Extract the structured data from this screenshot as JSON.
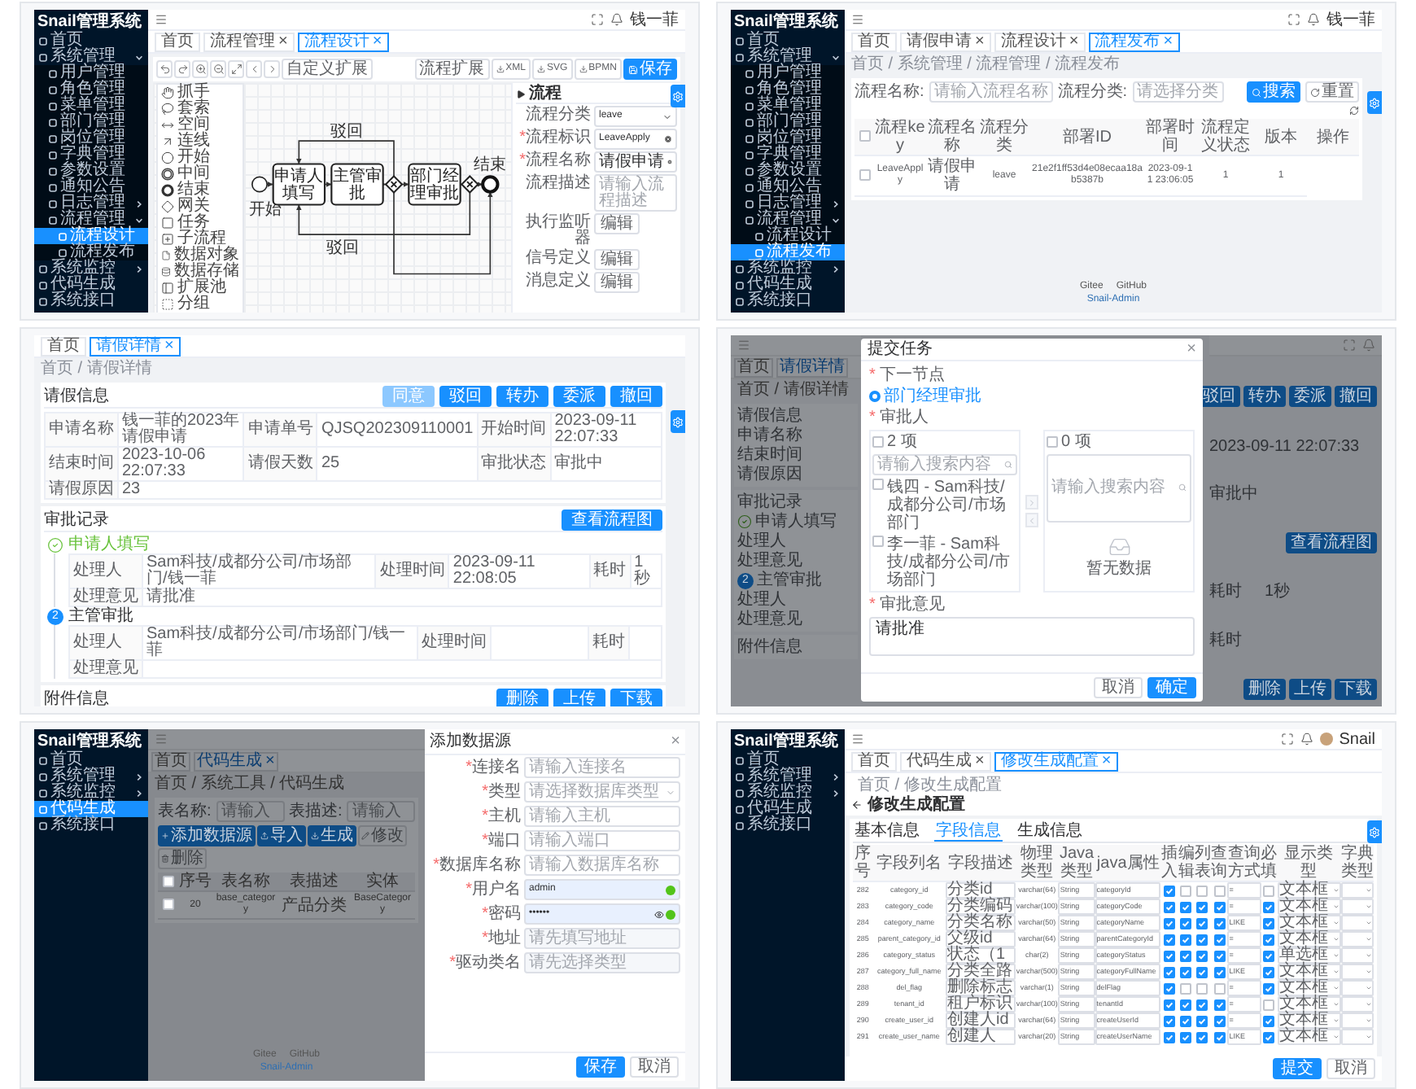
{
  "panels": [
    {
      "kind": "designer",
      "sidebar": {
        "title": "Snail管理系统",
        "items": [
          {
            "label": "首页",
            "selected": false
          },
          {
            "label": "系统管理",
            "selected": false,
            "expanded": true,
            "children": [
              {
                "label": "用户管理",
                "selected": false
              },
              {
                "label": "角色管理",
                "selected": false
              },
              {
                "label": "菜单管理",
                "selected": false
              },
              {
                "label": "部门管理",
                "selected": false
              },
              {
                "label": "岗位管理",
                "selected": false
              },
              {
                "label": "字典管理",
                "selected": false
              },
              {
                "label": "参数设置",
                "selected": false
              },
              {
                "label": "通知公告",
                "selected": false
              },
              {
                "label": "日志管理",
                "selected": false,
                "expanded": false
              },
              {
                "label": "流程管理",
                "selected": false,
                "expanded": true,
                "children": [
                  {
                    "label": "流程设计",
                    "selected": true
                  },
                  {
                    "label": "流程发布",
                    "selected": false
                  }
                ]
              }
            ]
          },
          {
            "label": "系统监控",
            "selected": false,
            "expanded": false
          },
          {
            "label": "代码生成",
            "selected": false
          },
          {
            "label": "系统接口",
            "selected": false
          }
        ]
      },
      "header": {
        "user": "钱一菲"
      },
      "tabs": [
        {
          "label": "首页",
          "selected": false
        },
        {
          "label": "流程管理",
          "close": "×",
          "selected": false
        },
        {
          "label": "流程设计",
          "close": "×",
          "selected": true
        }
      ],
      "tools": [
        {
          "kind": "undo"
        },
        {
          "kind": "redo"
        },
        {
          "kind": "zoom-in"
        },
        {
          "kind": "zoom-out"
        },
        {
          "kind": "fit"
        },
        {
          "kind": "left"
        },
        {
          "kind": "right"
        }
      ],
      "extension_button": "自定义扩展",
      "actions": [
        {
          "kind": "text",
          "label": "流程扩展",
          "primary": false
        },
        {
          "kind": "download",
          "label": "XML",
          "primary": false
        },
        {
          "kind": "download",
          "label": "SVG",
          "primary": false
        },
        {
          "kind": "download",
          "label": "BPMN",
          "primary": false
        },
        {
          "kind": "save",
          "label": "保存",
          "primary": true
        }
      ],
      "palette": [
        {
          "kind": "hand",
          "label": "抓手"
        },
        {
          "kind": "lasso",
          "label": "套索"
        },
        {
          "kind": "space",
          "label": "空间"
        },
        {
          "kind": "connect",
          "label": "连线"
        },
        {
          "kind": "start",
          "label": "开始"
        },
        {
          "kind": "intermediate",
          "label": "中间"
        },
        {
          "kind": "end",
          "label": "结束"
        },
        {
          "kind": "gateway",
          "label": "网关"
        },
        {
          "kind": "task",
          "label": "任务"
        },
        {
          "kind": "subprocess",
          "label": "子流程"
        },
        {
          "kind": "data-object",
          "label": "数据对象"
        },
        {
          "kind": "data-store",
          "label": "数据存储"
        },
        {
          "kind": "pool",
          "label": "扩展池"
        },
        {
          "kind": "group",
          "label": "分组"
        }
      ],
      "diagram": {
        "start_label": "开始",
        "end_label": "结束",
        "tasks": [
          "申请人填写",
          "主管审批",
          "部门经理审批"
        ],
        "flow_labels": [
          "驳回",
          "驳回"
        ]
      },
      "properties": {
        "title": "流程",
        "fields": [
          {
            "kind": "select",
            "label": "流程分类",
            "value": "leave"
          },
          {
            "kind": "input",
            "label": "流程标识",
            "value": "LeaveApply",
            "required": "*"
          },
          {
            "kind": "input",
            "label": "流程名称",
            "value": "请假申请",
            "required": "*"
          },
          {
            "kind": "textarea",
            "label": "流程描述",
            "placeholder": "请输入流程描述"
          },
          {
            "kind": "button",
            "label": "执行监听器",
            "value": "编辑"
          },
          {
            "kind": "button",
            "label": "信号定义",
            "value": "编辑"
          },
          {
            "kind": "button",
            "label": "消息定义",
            "value": "编辑"
          }
        ]
      }
    },
    {
      "kind": "deploy_list",
      "sidebar": {
        "title": "Snail管理系统",
        "items": [
          {
            "label": "首页",
            "selected": false
          },
          {
            "label": "系统管理",
            "selected": false,
            "expanded": true,
            "children": [
              {
                "label": "用户管理",
                "selected": false
              },
              {
                "label": "角色管理",
                "selected": false
              },
              {
                "label": "菜单管理",
                "selected": false
              },
              {
                "label": "部门管理",
                "selected": false
              },
              {
                "label": "岗位管理",
                "selected": false
              },
              {
                "label": "字典管理",
                "selected": false
              },
              {
                "label": "参数设置",
                "selected": false
              },
              {
                "label": "通知公告",
                "selected": false
              },
              {
                "label": "日志管理",
                "selected": false,
                "expanded": false
              },
              {
                "label": "流程管理",
                "selected": false,
                "expanded": true,
                "children": [
                  {
                    "label": "流程设计",
                    "selected": false
                  },
                  {
                    "label": "流程发布",
                    "selected": true
                  }
                ]
              }
            ]
          },
          {
            "label": "系统监控",
            "selected": false,
            "expanded": false
          },
          {
            "label": "代码生成",
            "selected": false
          },
          {
            "label": "系统接口",
            "selected": false
          }
        ]
      },
      "header": {
        "user": "钱一菲"
      },
      "tabs": [
        {
          "label": "首页",
          "selected": false
        },
        {
          "label": "请假申请",
          "close": "×",
          "selected": false
        },
        {
          "label": "流程设计",
          "close": "×",
          "selected": false
        },
        {
          "label": "流程发布",
          "close": "×",
          "selected": true
        }
      ],
      "breadcrumb": "首页 / 系统管理 / 流程管理 / 流程发布",
      "search": {
        "fields": [
          {
            "label": "流程名称:",
            "placeholder": "请输入流程名称"
          },
          {
            "label": "流程分类:",
            "placeholder": "请选择分类"
          }
        ],
        "buttons": [
          {
            "label": "搜索",
            "primary": true
          },
          {
            "label": "重置",
            "primary": false
          }
        ]
      },
      "table": {
        "all_checked": false,
        "columns": [
          "流程key",
          "流程名称",
          "流程分类",
          "部署ID",
          "部署时间",
          "流程定义状态",
          "版本",
          "操作"
        ],
        "rows": [
          {
            "checked": false,
            "cells": [
              "LeaveApply",
              "请假申请",
              "leave",
              "21e2f1ff53d4e08ecaa18ab5387b",
              "2023-09-11 23:06:05",
              "1",
              "1"
            ]
          }
        ]
      },
      "footer": {
        "links": [
          "Gitee",
          "GitHub"
        ],
        "brand": "Snail-Admin"
      }
    },
    {
      "kind": "detail",
      "tabs": [
        {
          "label": "首页",
          "selected": false
        },
        {
          "label": "请假详情",
          "close": "×",
          "selected": true
        }
      ],
      "breadcrumb": "首页 / 请假详情",
      "info": {
        "title": "请假信息",
        "buttons": [
          {
            "label": "同意",
            "disabled": true
          },
          {
            "label": "驳回",
            "disabled": false
          },
          {
            "label": "转办",
            "disabled": false
          },
          {
            "label": "委派",
            "disabled": false
          },
          {
            "label": "撤回",
            "disabled": false
          }
        ],
        "rows": [
          [
            {
              "label": "申请名称",
              "value": "钱一菲的2023年请假申请"
            },
            {
              "label": "申请单号",
              "value": "QJSQ202309110001"
            },
            {
              "label": "开始时间",
              "value": "2023-09-11 22:07:33"
            }
          ],
          [
            {
              "label": "结束时间",
              "value": "2023-10-06 22:07:33"
            },
            {
              "label": "请假天数",
              "value": "25"
            },
            {
              "label": "审批状态",
              "value": "审批中"
            }
          ],
          [
            {
              "label": "请假原因",
              "value": "23"
            }
          ]
        ]
      },
      "records": {
        "title": "审批记录",
        "button": "查看流程图",
        "steps": [
          {
            "title": "申请人填写",
            "done": true,
            "handler_label": "处理人",
            "handler": "Sam科技/成都分公司/市场部门/钱一菲",
            "time_label": "处理时间",
            "time": "2023-09-11 22:08:05",
            "duration_label": "耗时",
            "duration": "1秒",
            "opinion_label": "处理意见",
            "opinion": "请批准"
          },
          {
            "title": "主管审批",
            "done": false,
            "number": "2",
            "handler_label": "处理人",
            "handler": "Sam科技/成都分公司/市场部门/钱一菲",
            "time_label": "处理时间",
            "duration_label": "耗时",
            "opinion_label": "处理意见"
          }
        ]
      },
      "attachments": {
        "title": "附件信息",
        "buttons": [
          "删除",
          "上传",
          "下载"
        ]
      }
    },
    {
      "kind": "dialog",
      "backdrop": {
        "tabs": [
          {
            "label": "首页",
            "selected": false
          },
          {
            "label": "请假详情",
            "selected": true
          }
        ],
        "breadcrumb": "首页 / 请假详情",
        "sections": [
          {
            "title": "请假信息",
            "rows": [
              {
                "kind": "label",
                "text": "申请名称"
              },
              {
                "kind": "label",
                "text": "结束时间"
              },
              {
                "kind": "label",
                "text": "请假原因"
              }
            ]
          },
          {
            "title": "审批记录",
            "rows": [
              {
                "kind": "step",
                "text": "申请人填写",
                "done": true
              },
              {
                "kind": "label",
                "text": "处理人"
              },
              {
                "kind": "label",
                "text": "处理意见"
              },
              {
                "kind": "step",
                "text": "主管审批",
                "done": false,
                "number": "2"
              },
              {
                "kind": "label",
                "text": "处理人"
              },
              {
                "kind": "label",
                "text": "处理意见"
              }
            ]
          },
          {
            "title": "附件信息"
          }
        ],
        "right": [
          {
            "kind": "buttons",
            "labels": [
              "驳回",
              "转办",
              "委派",
              "撤回"
            ]
          },
          {
            "kind": "value",
            "text": "2023-09-11 22:07:33"
          },
          {
            "kind": "value",
            "text": "审批中"
          },
          {
            "kind": "buttons",
            "labels": [
              "查看流程图"
            ]
          },
          {
            "kind": "pair",
            "label": "耗时",
            "value": "1秒"
          },
          {
            "kind": "pair",
            "label": "耗时"
          },
          {
            "kind": "buttons",
            "labels": [
              "删除",
              "上传",
              "下载"
            ]
          }
        ]
      },
      "dialog": {
        "title": "提交任务",
        "close": "×",
        "required": "*",
        "next_label": "下一节点",
        "options": [
          {
            "label": "部门经理审批",
            "selected": true
          }
        ],
        "approver_label": "审批人",
        "source": {
          "all_checked": false,
          "count": "2 项",
          "search": "请输入搜索内容",
          "items": [
            {
              "label": "钱四 - Sam科技/成都分公司/市场部门",
              "checked": false
            },
            {
              "label": "李一菲 - Sam科技/成都分公司/市场部门",
              "checked": false
            }
          ]
        },
        "target": {
          "all_checked": false,
          "count": "0 项",
          "search": "请输入搜索内容",
          "empty": "暂无数据"
        },
        "opinion_label": "审批意见",
        "opinion": "请批准",
        "buttons": [
          {
            "label": "取消",
            "primary": false
          },
          {
            "label": "确定",
            "primary": true
          }
        ]
      }
    },
    {
      "kind": "drawer_form",
      "sidebar": {
        "title": "Snail管理系统",
        "items": [
          {
            "label": "首页",
            "selected": false
          },
          {
            "label": "系统管理",
            "selected": false,
            "expanded": false
          },
          {
            "label": "系统监控",
            "selected": false,
            "expanded": false
          },
          {
            "label": "代码生成",
            "selected": true
          },
          {
            "label": "系统接口",
            "selected": false
          }
        ]
      },
      "backdrop": {
        "tabs": [
          {
            "label": "首页",
            "selected": false
          },
          {
            "label": "代码生成",
            "close": "×",
            "selected": true
          }
        ],
        "breadcrumb": "首页 / 系统工具 / 代码生成",
        "search": [
          {
            "label": "表名称:",
            "placeholder": "请输入"
          },
          {
            "label": "表描述:",
            "placeholder": "请输入"
          }
        ],
        "buttons": [
          {
            "kind": "add",
            "label": "添加数据源",
            "disabled": false
          },
          {
            "kind": "import",
            "label": "导入",
            "disabled": false
          },
          {
            "kind": "generate",
            "label": "生成",
            "disabled": false
          },
          {
            "kind": "edit",
            "label": "修改",
            "disabled": true
          },
          {
            "kind": "delete",
            "label": "删除",
            "disabled": true
          }
        ],
        "table": {
          "all_checked": false,
          "columns": [
            "序号",
            "表名称",
            "表描述",
            "实体"
          ],
          "rows": [
            {
              "checked": false,
              "cells": [
                "20",
                "base_category",
                "产品分类",
                "BaseCategory"
              ]
            }
          ]
        },
        "footer": {
          "links": [
            "Gitee",
            "GitHub"
          ],
          "brand": "Snail-Admin"
        }
      },
      "drawer": {
        "title": "添加数据源",
        "close": "×",
        "required": "*",
        "fields": [
          {
            "kind": "input",
            "label": "连接名",
            "placeholder": "请输入连接名"
          },
          {
            "kind": "select",
            "label": "类型",
            "placeholder": "请选择数据库类型"
          },
          {
            "kind": "input",
            "label": "主机",
            "placeholder": "请输入主机"
          },
          {
            "kind": "input",
            "label": "端口",
            "placeholder": "请输入端口"
          },
          {
            "kind": "input",
            "label": "数据库名称",
            "placeholder": "请输入数据库名称"
          },
          {
            "kind": "autofill",
            "label": "用户名",
            "value": "admin"
          },
          {
            "kind": "password",
            "label": "密码",
            "value": "••••••"
          },
          {
            "kind": "disabled",
            "label": "地址",
            "placeholder": "请先填写地址"
          },
          {
            "kind": "disabled",
            "label": "驱动类名",
            "placeholder": "请先选择类型"
          }
        ],
        "buttons": [
          {
            "label": "保存",
            "primary": true
          },
          {
            "label": "取消",
            "primary": false
          }
        ]
      }
    },
    {
      "kind": "gen_config",
      "sidebar": {
        "title": "Snail管理系统",
        "items": [
          {
            "label": "首页",
            "selected": false
          },
          {
            "label": "系统管理",
            "selected": false,
            "expanded": false
          },
          {
            "label": "系统监控",
            "selected": false,
            "expanded": false
          },
          {
            "label": "代码生成",
            "selected": false
          },
          {
            "label": "系统接口",
            "selected": false
          }
        ]
      },
      "header": {
        "user": "Snail",
        "avatar": true
      },
      "tabs": [
        {
          "label": "首页",
          "selected": false
        },
        {
          "label": "代码生成",
          "close": "×",
          "selected": false
        },
        {
          "label": "修改生成配置",
          "close": "×",
          "selected": true
        }
      ],
      "breadcrumb": "首页 / 修改生成配置",
      "page_title": "修改生成配置",
      "inner_tabs": [
        {
          "label": "基本信息",
          "selected": false
        },
        {
          "label": "字段信息",
          "selected": true
        },
        {
          "label": "生成信息",
          "selected": false
        }
      ],
      "columns": [
        "序号",
        "字段列名",
        "字段描述",
        "物理类型",
        "Java类型",
        "java属性",
        "插入",
        "编辑",
        "列表",
        "查询",
        "查询方式",
        "必填",
        "显示类型",
        "字典类型"
      ],
      "rows": [
        {
          "no": "282",
          "column": "category_id",
          "comment": "分类id",
          "db_type": "varchar(64)",
          "java_type": "String",
          "field": "categoryId",
          "insert": true,
          "edit": false,
          "list": false,
          "query": false,
          "query_type": "=",
          "required": false,
          "html_type": "文本框"
        },
        {
          "no": "283",
          "column": "category_code",
          "comment": "分类编码",
          "db_type": "varchar(100)",
          "java_type": "String",
          "field": "categoryCode",
          "insert": true,
          "edit": true,
          "list": true,
          "query": true,
          "query_type": "=",
          "required": true,
          "html_type": "文本框"
        },
        {
          "no": "284",
          "column": "category_name",
          "comment": "分类名称",
          "db_type": "varchar(50)",
          "java_type": "String",
          "field": "categoryName",
          "insert": true,
          "edit": true,
          "list": true,
          "query": true,
          "query_type": "LIKE",
          "required": true,
          "html_type": "文本框"
        },
        {
          "no": "285",
          "column": "parent_category_id",
          "comment": "父级id",
          "db_type": "varchar(64)",
          "java_type": "String",
          "field": "parentCategoryId",
          "insert": true,
          "edit": true,
          "list": true,
          "query": true,
          "query_type": "=",
          "required": true,
          "html_type": "文本框"
        },
        {
          "no": "286",
          "column": "category_status",
          "comment": "状态（1",
          "db_type": "char(2)",
          "java_type": "String",
          "field": "categoryStatus",
          "insert": true,
          "edit": true,
          "list": true,
          "query": true,
          "query_type": "=",
          "required": true,
          "html_type": "单选框"
        },
        {
          "no": "287",
          "column": "category_full_name",
          "comment": "分类全路",
          "db_type": "varchar(500)",
          "java_type": "String",
          "field": "categoryFullName",
          "insert": true,
          "edit": true,
          "list": true,
          "query": true,
          "query_type": "LIKE",
          "required": true,
          "html_type": "文本框"
        },
        {
          "no": "288",
          "column": "del_flag",
          "comment": "删除标志",
          "db_type": "varchar(1)",
          "java_type": "String",
          "field": "delFlag",
          "insert": true,
          "edit": false,
          "list": false,
          "query": false,
          "query_type": "=",
          "required": true,
          "html_type": "文本框"
        },
        {
          "no": "289",
          "column": "tenant_id",
          "comment": "租户标识",
          "db_type": "varchar(100)",
          "java_type": "String",
          "field": "tenantId",
          "insert": true,
          "edit": true,
          "list": true,
          "query": true,
          "query_type": "=",
          "required": false,
          "html_type": "文本框"
        },
        {
          "no": "290",
          "column": "create_user_id",
          "comment": "创建人id",
          "db_type": "varchar(64)",
          "java_type": "String",
          "field": "createUserId",
          "insert": true,
          "edit": true,
          "list": true,
          "query": true,
          "query_type": "=",
          "required": true,
          "html_type": "文本框"
        },
        {
          "no": "291",
          "column": "create_user_name",
          "comment": "创建人",
          "db_type": "varchar(20)",
          "java_type": "String",
          "field": "createUserName",
          "insert": true,
          "edit": true,
          "list": true,
          "query": true,
          "query_type": "LIKE",
          "required": true,
          "html_type": "文本框"
        }
      ],
      "buttons": [
        {
          "label": "提交",
          "primary": true
        },
        {
          "label": "取消",
          "primary": false
        }
      ]
    }
  ]
}
